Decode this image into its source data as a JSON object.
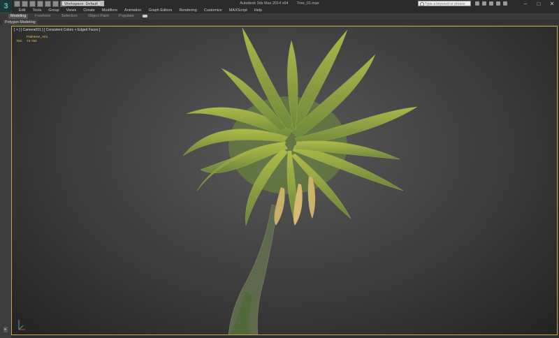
{
  "title_bar": {
    "app_name": "Autodesk 3ds Max 2014 x64",
    "file_name": "Tree_01.max",
    "workspace_label": "Workspace: Default",
    "search_placeholder": "Type a keyword or phrase",
    "logo_glyph": "3",
    "minimize_glyph": "–",
    "maximize_glyph": "□",
    "close_glyph": "✕"
  },
  "menu": [
    "Edit",
    "Tools",
    "Group",
    "Views",
    "Create",
    "Modifiers",
    "Animation",
    "Graph Editors",
    "Rendering",
    "Customize",
    "MAXScript",
    "Help"
  ],
  "ribbon": {
    "tabs": [
      "Modeling",
      "Freeform",
      "Selection",
      "Object Paint",
      "Populate"
    ],
    "active_tab": "Modeling",
    "panel_label": "Polygon Modeling"
  },
  "viewport": {
    "label": "[ + ] [ Camera001 ] [ Consistent Colors + Edged Faces ]",
    "stats": {
      "object_name": "Palmtree_A01",
      "tris_label": "Tris:",
      "tris_value": "74 782"
    },
    "axis": {
      "x": "x",
      "y": "y",
      "z": "z"
    }
  },
  "left_strip": {
    "expand_glyph": "▸"
  },
  "colors": {
    "viewport_border": "#c8a24a",
    "stats_text": "#e6c35a",
    "frond_green": "#8fa83a",
    "trunk": "#5f6a4d"
  }
}
